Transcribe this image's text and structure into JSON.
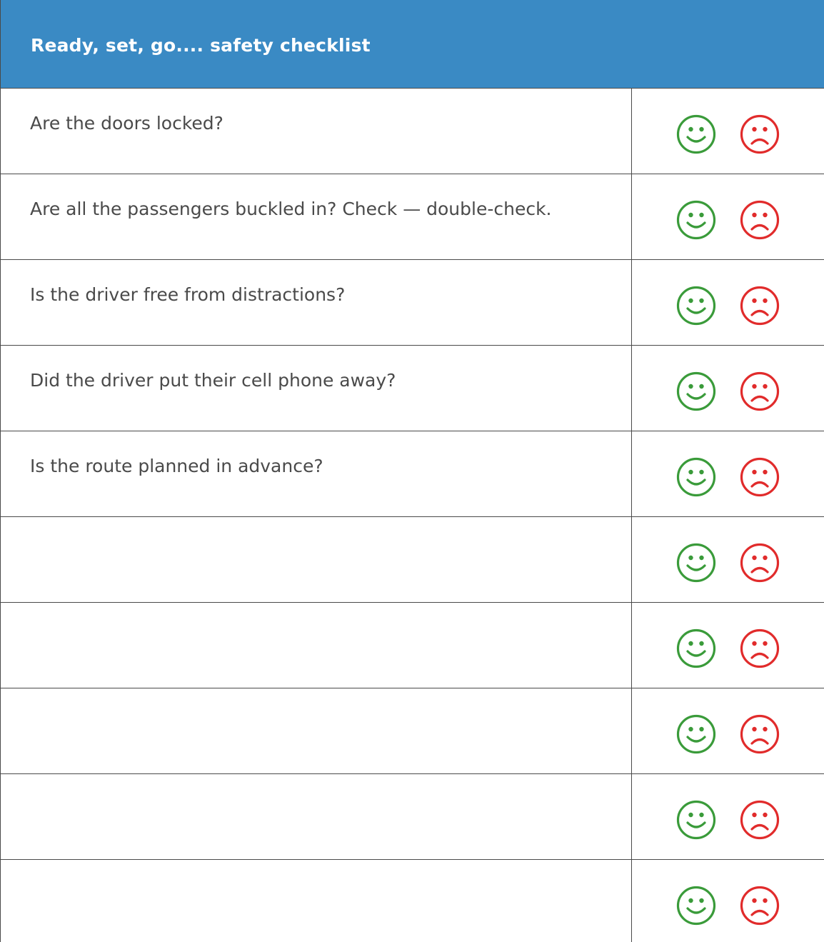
{
  "header": {
    "title": "Ready, set, go.... safety checklist"
  },
  "colors": {
    "header_bg": "#3a8ac4",
    "happy": "#3a9b3a",
    "sad": "#e12b2b",
    "text": "#4a4a4a"
  },
  "icons": {
    "yes": "smiley-face-icon",
    "no": "frowning-face-icon"
  },
  "rows": [
    {
      "question": "Are the doors locked?"
    },
    {
      "question": "Are all the passengers buckled in? Check — double-check."
    },
    {
      "question": "Is the driver free from distractions?"
    },
    {
      "question": "Did the driver put their cell phone away?"
    },
    {
      "question": "Is the route planned in advance?"
    },
    {
      "question": ""
    },
    {
      "question": ""
    },
    {
      "question": ""
    },
    {
      "question": ""
    },
    {
      "question": ""
    }
  ]
}
